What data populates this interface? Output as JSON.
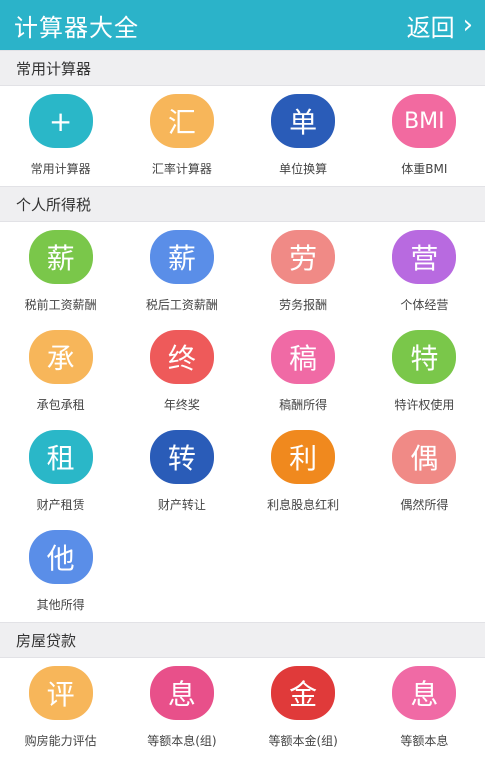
{
  "header": {
    "title": "计算器大全",
    "back_label": "返回",
    "chevron": "›"
  },
  "sections": [
    {
      "title": "常用计算器",
      "items": [
        {
          "glyph": "+",
          "label": "常用计算器",
          "color": "#2ab7c8"
        },
        {
          "glyph": "汇",
          "label": "汇率计算器",
          "color": "#f7b65a"
        },
        {
          "glyph": "单",
          "label": "单位换算",
          "color": "#2a5cb8"
        },
        {
          "glyph": "BMI",
          "label": "体重BMI",
          "color": "#f26aa0"
        }
      ]
    },
    {
      "title": "个人所得税",
      "items": [
        {
          "glyph": "薪",
          "label": "税前工资薪酬",
          "color": "#7ac74a"
        },
        {
          "glyph": "薪",
          "label": "税后工资薪酬",
          "color": "#5a8ee8"
        },
        {
          "glyph": "劳",
          "label": "劳务报酬",
          "color": "#f08a86"
        },
        {
          "glyph": "营",
          "label": "个体经营",
          "color": "#b86ae0"
        },
        {
          "glyph": "承",
          "label": "承包承租",
          "color": "#f7b65a"
        },
        {
          "glyph": "终",
          "label": "年终奖",
          "color": "#ee5a5a"
        },
        {
          "glyph": "稿",
          "label": "稿酬所得",
          "color": "#f06aa5"
        },
        {
          "glyph": "特",
          "label": "特许权使用",
          "color": "#7ac74a"
        },
        {
          "glyph": "租",
          "label": "财产租赁",
          "color": "#2ab7c8"
        },
        {
          "glyph": "转",
          "label": "财产转让",
          "color": "#2a5cb8"
        },
        {
          "glyph": "利",
          "label": "利息股息红利",
          "color": "#f0891e"
        },
        {
          "glyph": "偶",
          "label": "偶然所得",
          "color": "#f08a86"
        },
        {
          "glyph": "他",
          "label": "其他所得",
          "color": "#5a8ee8"
        }
      ]
    },
    {
      "title": "房屋贷款",
      "items": [
        {
          "glyph": "评",
          "label": "购房能力评估",
          "color": "#f7b65a"
        },
        {
          "glyph": "息",
          "label": "等额本息(组)",
          "color": "#e8508a"
        },
        {
          "glyph": "金",
          "label": "等额本金(组)",
          "color": "#e03a3a"
        },
        {
          "glyph": "息",
          "label": "等额本息",
          "color": "#f06aa5"
        }
      ]
    }
  ]
}
